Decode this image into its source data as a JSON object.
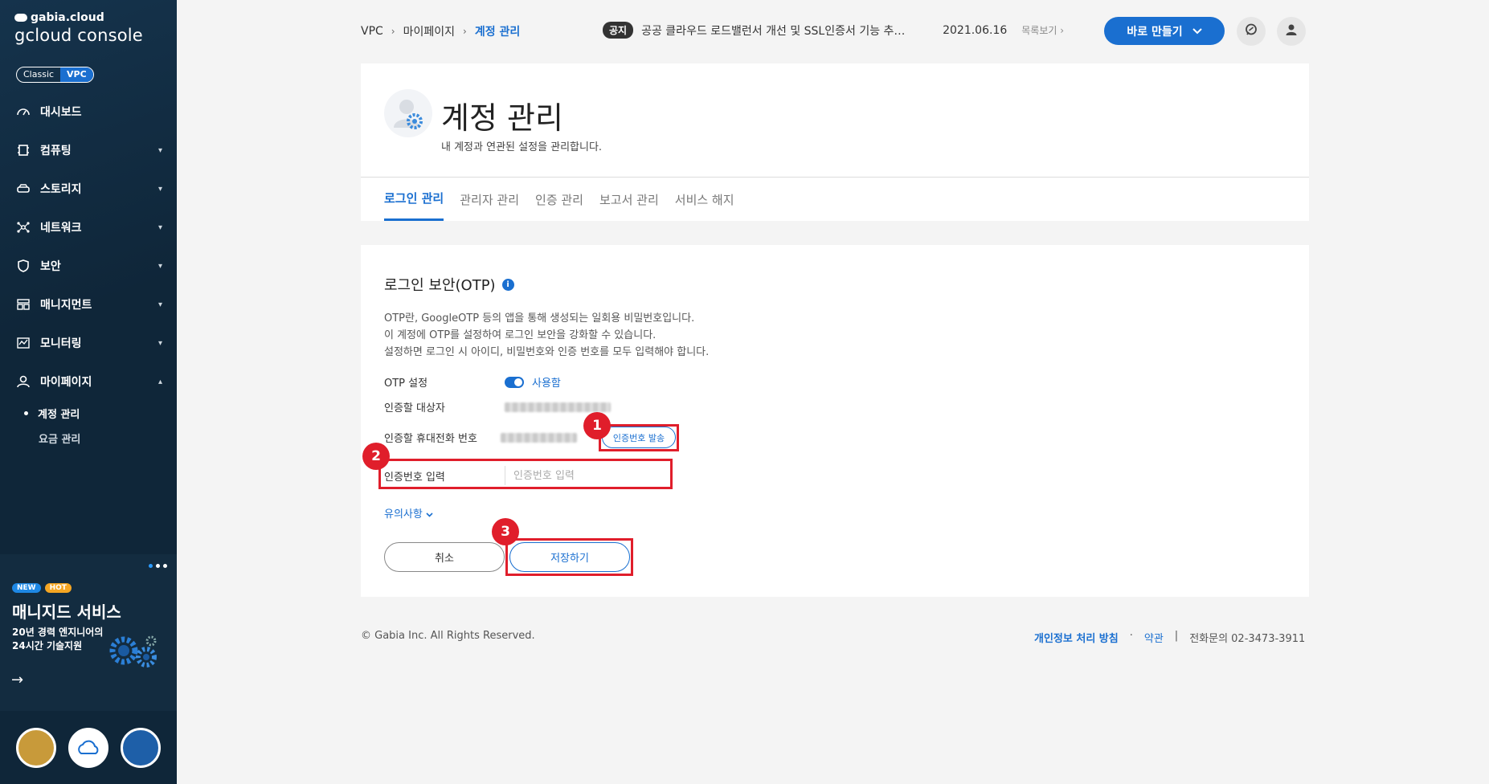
{
  "sidebar": {
    "logo_small": "gabia.cloud",
    "logo_main": "gcloud console",
    "env": [
      "Classic",
      "VPC"
    ],
    "items": [
      {
        "label": "대시보드",
        "icon": "dashboard-icon"
      },
      {
        "label": "컴퓨팅",
        "icon": "chip-icon"
      },
      {
        "label": "스토리지",
        "icon": "storage-icon"
      },
      {
        "label": "네트워크",
        "icon": "network-icon"
      },
      {
        "label": "보안",
        "icon": "shield-icon"
      },
      {
        "label": "매니지먼트",
        "icon": "management-icon"
      },
      {
        "label": "모니터링",
        "icon": "monitor-icon"
      },
      {
        "label": "마이페이지",
        "icon": "user-icon"
      }
    ],
    "sub_items": [
      "계정 관리",
      "요금 관리"
    ]
  },
  "promo": {
    "badge_new": "NEW",
    "badge_hot": "HOT",
    "title": "매니지드 서비스",
    "desc_line1": "20년 경력 엔지니어의",
    "desc_line2": "24시간 기술지원"
  },
  "header": {
    "breadcrumb": [
      "VPC",
      "마이페이지",
      "계정 관리"
    ],
    "notice_tag": "공지",
    "notice_text": "공공 클라우드 로드밸런서 개선 및 SSL인증서 기능 추…",
    "notice_date": "2021.06.16",
    "notice_more": "목록보기",
    "make_button": "바로 만들기"
  },
  "page": {
    "title": "계정 관리",
    "subtitle": "내 계정과 연관된 설정을 관리합니다.",
    "tabs": [
      "로그인 관리",
      "관리자 관리",
      "인증 관리",
      "보고서 관리",
      "서비스 해지"
    ]
  },
  "otp": {
    "section_title": "로그인 보안(OTP)",
    "desc": [
      "OTP란, GoogleOTP 등의 앱을 통해 생성되는 일회용 비밀번호입니다.",
      "이 계정에 OTP를 설정하여 로그인 보안을 강화할 수 있습니다.",
      "설정하면 로그인 시 아이디, 비밀번호와 인증 번호를 모두 입력해야 합니다."
    ],
    "setting_label": "OTP 설정",
    "setting_value": "사용함",
    "target_label": "인증할 대상자",
    "phone_label": "인증할 휴대전화 번호",
    "send_button": "인증번호 발송",
    "code_label": "인증번호 입력",
    "code_placeholder": "인증번호 입력",
    "caution": "유의사항",
    "cancel_button": "취소",
    "save_button": "저장하기"
  },
  "annotations": [
    "1",
    "2",
    "3"
  ],
  "footer": {
    "copyright": "© Gabia Inc. All Rights Reserved.",
    "privacy": "개인정보 처리 방침",
    "dot": "·",
    "terms": "약관",
    "pipe": "|",
    "phone": "전화문의  02-3473-3911"
  },
  "colors": {
    "accent": "#1a6fd0",
    "sidebar": "#0f2639",
    "annotation": "#e01e2b"
  }
}
